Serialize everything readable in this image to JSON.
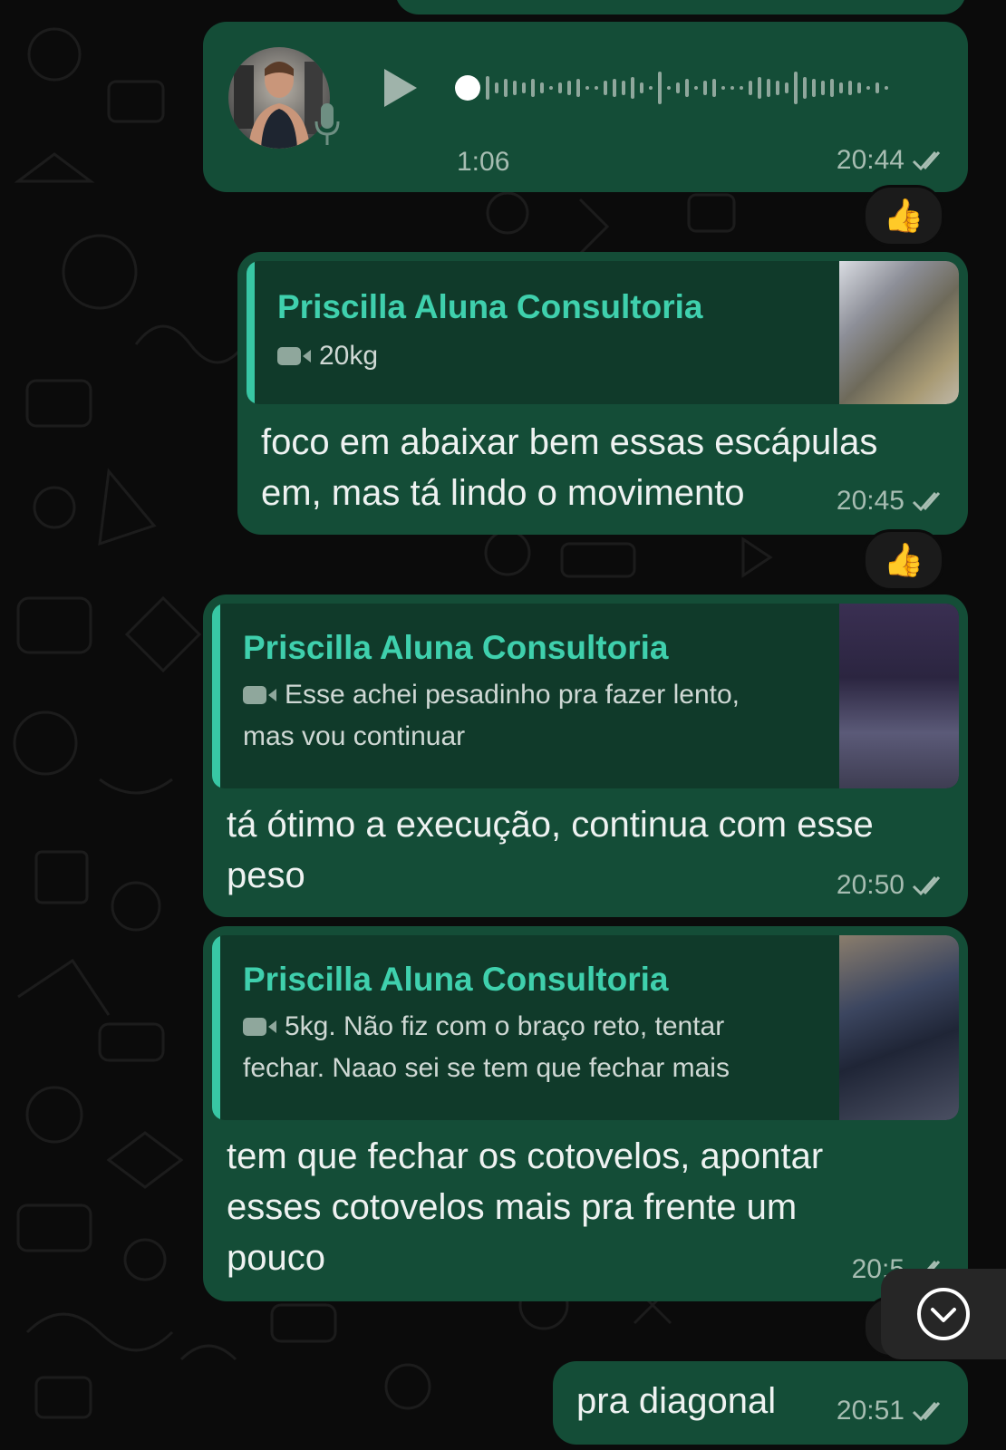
{
  "voice_message": {
    "duration": "1:06",
    "time": "20:44",
    "reaction": "👍"
  },
  "messages": [
    {
      "quote_author": "Priscilla Aluna Consultoria",
      "quote_text": "20kg",
      "text_lines": [
        "foco em abaixar bem essas escápulas",
        "em, mas tá lindo o movimento"
      ],
      "time": "20:45",
      "reaction": "👍"
    },
    {
      "quote_author": "Priscilla Aluna Consultoria",
      "quote_text_lines": [
        "Esse achei pesadinho pra fazer lento,",
        "mas vou continuar"
      ],
      "text_lines": [
        "tá ótimo a execução, continua com esse",
        "peso"
      ],
      "time": "20:50"
    },
    {
      "quote_author": "Priscilla Aluna Consultoria",
      "quote_text_lines": [
        "5kg. Não fiz com o braço reto, tentar",
        "fechar. Naao sei se tem que fechar mais"
      ],
      "text_lines": [
        "tem que fechar os cotovelos, apontar",
        "esses cotovelos mais pra frente um",
        "pouco"
      ],
      "time": "20:5"
    },
    {
      "text": "pra diagonal",
      "time": "20:51"
    }
  ],
  "icons": [
    "play-icon",
    "microphone-icon",
    "double-check-icon",
    "video-camera-icon",
    "chevron-down-icon"
  ],
  "colors": {
    "background": "#0b0b0b",
    "bubble": "#144d37",
    "quote_background": "#103a2a",
    "accent": "#3fd0ad",
    "timestamp": "#a7bdb2"
  }
}
